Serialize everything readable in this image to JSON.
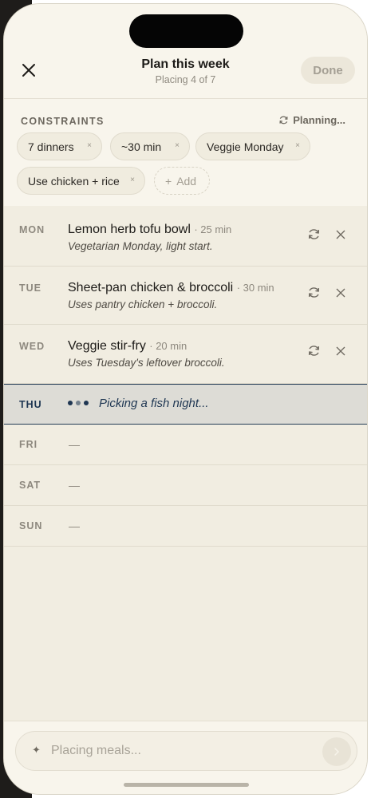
{
  "header": {
    "title": "Plan this week",
    "subtitle": "Placing 4 of 7",
    "done_label": "Done",
    "close_icon": "close-icon"
  },
  "constraints": {
    "label": "CONSTRAINTS",
    "status": "Planning...",
    "chips": [
      {
        "label": "7 dinners",
        "remove": "×"
      },
      {
        "label": "~30 min",
        "remove": "×"
      },
      {
        "label": "Veggie Monday",
        "remove": "×"
      },
      {
        "label": "Use chicken + rice",
        "remove": "×"
      }
    ],
    "add_label": "Add",
    "add_symbol": "+"
  },
  "days": [
    {
      "day": "MON",
      "meal": "Lemon herb tofu bowl",
      "time": "· 25 min",
      "note": "Vegetarian Monday, light start."
    },
    {
      "day": "TUE",
      "meal": "Sheet-pan chicken & broccoli",
      "time": "· 30 min",
      "note": "Uses pantry chicken + broccoli."
    },
    {
      "day": "WED",
      "meal": "Veggie stir-fry",
      "time": "· 20 min",
      "note": "Uses Tuesday's leftover broccoli."
    },
    {
      "day": "THU",
      "status": "Picking a fish night..."
    },
    {
      "day": "FRI",
      "placeholder": "—"
    },
    {
      "day": "SAT",
      "placeholder": "—"
    },
    {
      "day": "SUN",
      "placeholder": "—"
    }
  ],
  "composer": {
    "placeholder": "Placing meals...",
    "sparkle": "✦"
  },
  "colors": {
    "background": "#f1ede1",
    "accent": "#1e3652"
  }
}
